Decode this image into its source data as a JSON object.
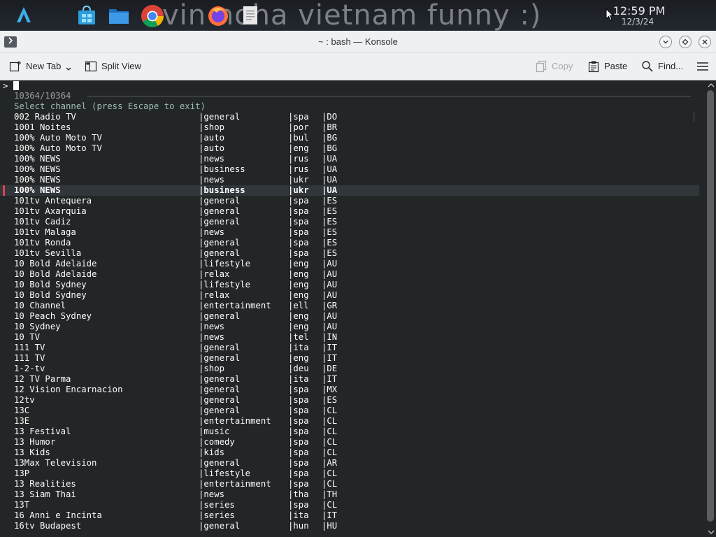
{
  "taskbar": {
    "wallpaper_text": "vin noha vietnam funny :)",
    "clock_time": "12:59 PM",
    "clock_date": "12/3/24",
    "apps": [
      "launcher-icon",
      "store-icon",
      "file-manager-icon",
      "chrome-icon",
      "firefox-icon",
      "text-editor-icon"
    ]
  },
  "window": {
    "title": "~ : bash — Konsole"
  },
  "toolbar": {
    "new_tab": "New Tab",
    "split_view": "Split View",
    "copy": "Copy",
    "paste": "Paste",
    "find": "Find..."
  },
  "terminal": {
    "prompt": ">",
    "count": "10364/10364",
    "header": "Select channel (press Escape to exit)",
    "selected_index": 7,
    "rows": [
      [
        "002 Radio TV",
        "|general",
        "|spa",
        "|DO"
      ],
      [
        "1001 Noites",
        "|shop",
        "|por",
        "|BR"
      ],
      [
        "100% Auto Moto TV",
        "|auto",
        "|bul",
        "|BG"
      ],
      [
        "100% Auto Moto TV",
        "|auto",
        "|eng",
        "|BG"
      ],
      [
        "100% NEWS",
        "|news",
        "|rus",
        "|UA"
      ],
      [
        "100% NEWS",
        "|business",
        "|rus",
        "|UA"
      ],
      [
        "100% NEWS",
        "|news",
        "|ukr",
        "|UA"
      ],
      [
        "100% NEWS",
        "|business",
        "|ukr",
        "|UA"
      ],
      [
        "101tv Antequera",
        "|general",
        "|spa",
        "|ES"
      ],
      [
        "101tv Axarquia",
        "|general",
        "|spa",
        "|ES"
      ],
      [
        "101tv Cadiz",
        "|general",
        "|spa",
        "|ES"
      ],
      [
        "101tv Malaga",
        "|news",
        "|spa",
        "|ES"
      ],
      [
        "101tv Ronda",
        "|general",
        "|spa",
        "|ES"
      ],
      [
        "101tv Sevilla",
        "|general",
        "|spa",
        "|ES"
      ],
      [
        "10 Bold Adelaide",
        "|lifestyle",
        "|eng",
        "|AU"
      ],
      [
        "10 Bold Adelaide",
        "|relax",
        "|eng",
        "|AU"
      ],
      [
        "10 Bold Sydney",
        "|lifestyle",
        "|eng",
        "|AU"
      ],
      [
        "10 Bold Sydney",
        "|relax",
        "|eng",
        "|AU"
      ],
      [
        "10 Channel",
        "|entertainment",
        "|ell",
        "|GR"
      ],
      [
        "10 Peach Sydney",
        "|general",
        "|eng",
        "|AU"
      ],
      [
        "10 Sydney",
        "|news",
        "|eng",
        "|AU"
      ],
      [
        "10 TV",
        "|news",
        "|tel",
        "|IN"
      ],
      [
        "111 TV",
        "|general",
        "|ita",
        "|IT"
      ],
      [
        "111 TV",
        "|general",
        "|eng",
        "|IT"
      ],
      [
        "1-2-tv",
        "|shop",
        "|deu",
        "|DE"
      ],
      [
        "12 TV Parma",
        "|general",
        "|ita",
        "|IT"
      ],
      [
        "12 Vision Encarnacion",
        "|general",
        "|spa",
        "|MX"
      ],
      [
        "12tv",
        "|general",
        "|spa",
        "|ES"
      ],
      [
        "13C",
        "|general",
        "|spa",
        "|CL"
      ],
      [
        "13E",
        "|entertainment",
        "|spa",
        "|CL"
      ],
      [
        "13 Festival",
        "|music",
        "|spa",
        "|CL"
      ],
      [
        "13 Humor",
        "|comedy",
        "|spa",
        "|CL"
      ],
      [
        "13 Kids",
        "|kids",
        "|spa",
        "|CL"
      ],
      [
        "13Max Television",
        "|general",
        "|spa",
        "|AR"
      ],
      [
        "13P",
        "|lifestyle",
        "|spa",
        "|CL"
      ],
      [
        "13 Realities",
        "|entertainment",
        "|spa",
        "|CL"
      ],
      [
        "13 Siam Thai",
        "|news",
        "|tha",
        "|TH"
      ],
      [
        "13T",
        "|series",
        "|spa",
        "|CL"
      ],
      [
        "16 Anni e Incinta",
        "|series",
        "|ita",
        "|IT"
      ],
      [
        "16tv Budapest",
        "|general",
        "|hun",
        "|HU"
      ]
    ]
  }
}
